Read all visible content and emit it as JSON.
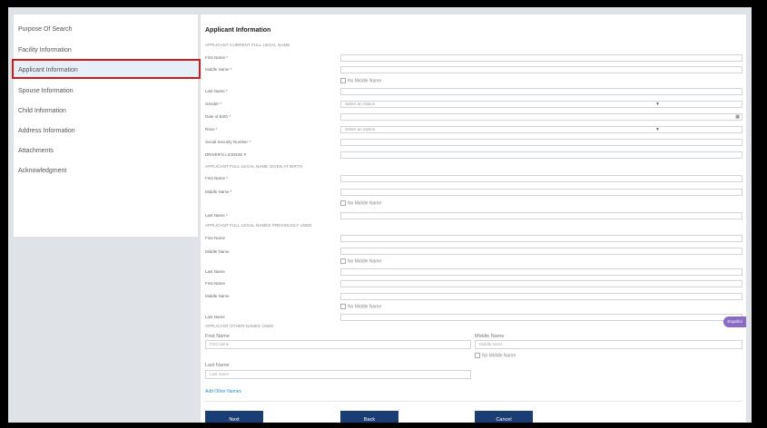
{
  "sidebar": {
    "items": [
      {
        "label": "Purpose Of Search"
      },
      {
        "label": "Facility Information"
      },
      {
        "label": "Applicant Information"
      },
      {
        "label": "Spouse Information"
      },
      {
        "label": "Child Information"
      },
      {
        "label": "Address Information"
      },
      {
        "label": "Attachments"
      },
      {
        "label": "Acknowledgment"
      }
    ],
    "active_index": 2
  },
  "form": {
    "title": "Applicant Information",
    "sections": {
      "current": "APPLICANT CURRENT FULL LEGAL NAME",
      "birth": "APPLICANT FULL LEGAL NAME GIVEN AT BIRTH",
      "previous": "APPLICANT FULL LEGAL NAMES PREVIOUSLY USED",
      "other": "APPLICANT OTHER NAMES USED"
    },
    "labels": {
      "first_name": "First Name",
      "middle_name": "Middle Name",
      "last_name": "Last Name",
      "gender": "Gender",
      "dob": "Date of Birth",
      "race": "Race",
      "ssn": "Social Security Number",
      "dl": "DRIVER'S LICENSE #",
      "no_middle": "No Middle Name",
      "required": "*"
    },
    "select_placeholder": "Select an Option",
    "other_names": {
      "first_label": "First Name",
      "middle_label": "Middle Name",
      "last_label": "Last Name",
      "first_ph": "First name",
      "middle_ph": "Middle name",
      "last_ph": "Last name"
    },
    "add_other": "Add Other Names",
    "espanol": "Español"
  },
  "buttons": {
    "next": "Next",
    "back": "Back",
    "cancel": "Cancel"
  }
}
